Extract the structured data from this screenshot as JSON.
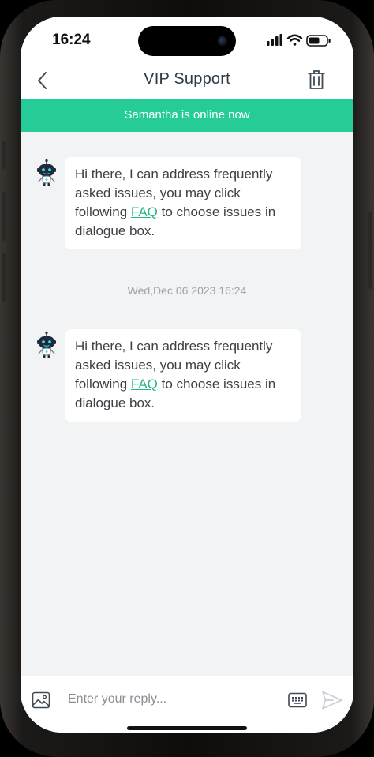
{
  "status_bar": {
    "time": "16:24"
  },
  "nav": {
    "title": "VIP Support",
    "back_icon": "chevron-left-icon",
    "trash_icon": "trash-icon"
  },
  "banner": {
    "text": "Samantha is online now",
    "color": "#25cc98"
  },
  "messages": [
    {
      "pre": "Hi there, I can address frequently asked issues, you may click following ",
      "link": "FAQ",
      "post": " to choose issues in dialogue box."
    },
    {
      "pre": "Hi there, I can address frequently asked issues, you may click following ",
      "link": "FAQ",
      "post": " to choose issues in dialogue box."
    }
  ],
  "timestamp": "Wed,Dec 06 2023 16:24",
  "composer": {
    "placeholder": "Enter your reply...",
    "value": "",
    "icons": [
      "image-icon",
      "keyboard-icon",
      "send-icon"
    ]
  },
  "colors": {
    "accent": "#25cc98",
    "link": "#25b784",
    "background": "#f2f3f5"
  }
}
